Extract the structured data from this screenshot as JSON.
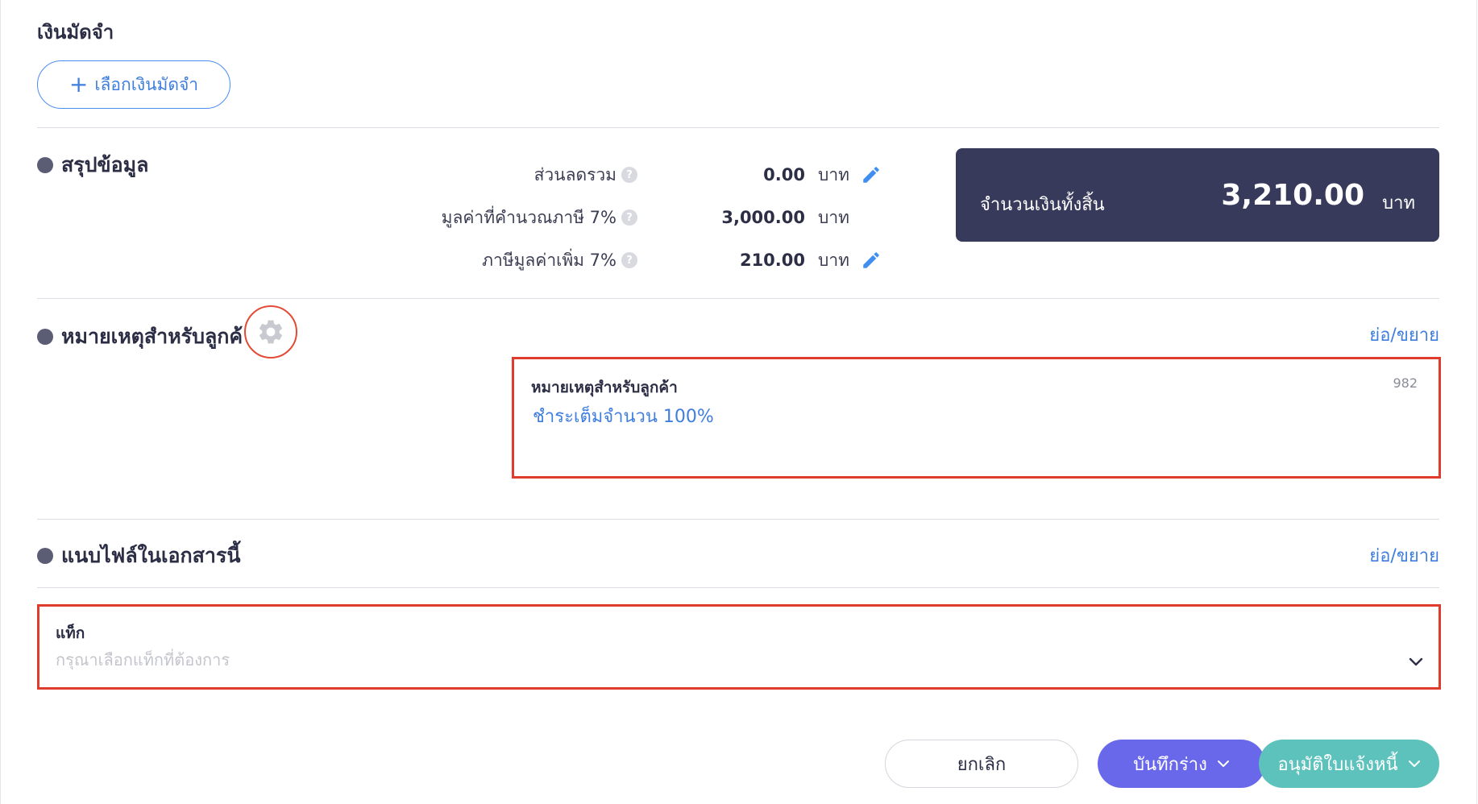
{
  "deposit": {
    "title": "เงินมัดจำ",
    "add_button": "เลือกเงินมัดจำ"
  },
  "summary": {
    "title": "สรุปข้อมูล",
    "rows": [
      {
        "label": "ส่วนลดรวม",
        "value": "0.00",
        "unit": "บาท",
        "editable": true
      },
      {
        "label": "มูลค่าที่คำนวณภาษี 7%",
        "value": "3,000.00",
        "unit": "บาท",
        "editable": false
      },
      {
        "label": "ภาษีมูลค่าเพิ่ม 7%",
        "value": "210.00",
        "unit": "บาท",
        "editable": true
      }
    ],
    "total": {
      "label": "จำนวนเงินทั้งสิ้น",
      "amount": "3,210.00",
      "unit": "บาท"
    }
  },
  "notes": {
    "title": "หมายเหตุสำหรับลูกค้",
    "toggle": "ย่อ/ขยาย",
    "field_label": "หมายเหตุสำหรับลูกค้า",
    "char_count": "982",
    "value": "ชำระเต็มจำนวน 100%"
  },
  "attachments": {
    "title": "แนบไฟล์ในเอกสารนี้",
    "toggle": "ย่อ/ขยาย",
    "tag_label": "แท็ก",
    "tag_placeholder": "กรุณาเลือกแท็กที่ต้องการ"
  },
  "footer": {
    "cancel": "ยกเลิก",
    "save_draft": "บันทึกร่าง",
    "approve": "อนุมัติใบแจ้งหนี้"
  },
  "colors": {
    "primary_blue": "#3f7ede",
    "total_bg": "#383a5c",
    "draft_purple": "#6a68ea",
    "approve_teal": "#5ec2bc",
    "highlight_red": "#e03c2d"
  }
}
